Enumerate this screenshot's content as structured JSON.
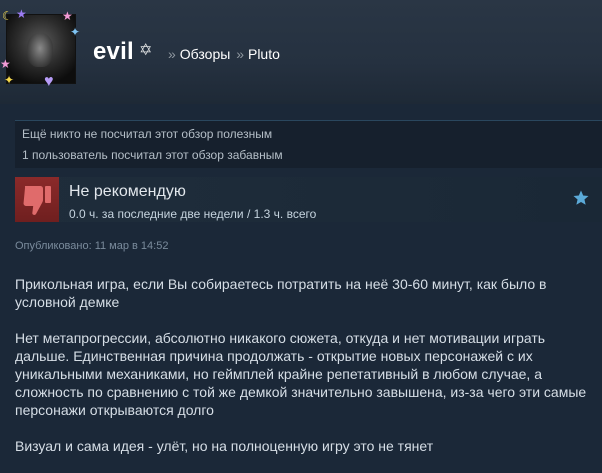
{
  "header": {
    "username": "evil",
    "username_symbol": "✡",
    "breadcrumb": {
      "separator": "»",
      "reviews_label": "Обзоры",
      "game_label": "Pluto"
    }
  },
  "helpfulness": {
    "line1": "Ещё никто не посчитал этот обзор полезным",
    "line2": "1 пользователь посчитал этот обзор забавным"
  },
  "review": {
    "verdict": "Не рекомендую",
    "hours": "0.0 ч. за последние две недели / 1.3 ч. всего",
    "posted": "Опубликовано: 11 мар в 14:52",
    "paragraphs": [
      "Прикольная игра, если Вы собираетесь потратить на неё 30-60 минут, как было в условной демке",
      "Нет метапрогрессии, абсолютно никакого сюжета, откуда и нет мотивации играть дальше. Единственная причина продолжать - открытие новых персонажей с их уникальными механиками, но геймплей крайне репетативный в любом случае, а сложность по сравнению с той же демкой значительно завышена, из-за чего эти самые персонажи открываются долго",
      "Визуал и сама идея - улёт, но на полноценную игру это не тянет"
    ]
  },
  "icons": {
    "thumb": "thumbs-down-icon",
    "favorite": "star-icon"
  },
  "colors": {
    "background": "#1b2838",
    "thumb_bg": "#8b2a2a",
    "star": "#67c1f5"
  }
}
